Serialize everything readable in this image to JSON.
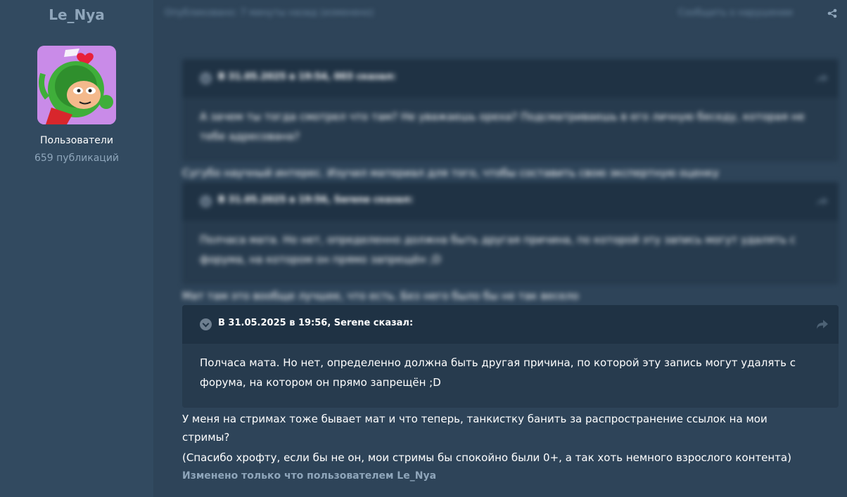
{
  "author": {
    "name": "Le_Nya",
    "group": "Пользователи",
    "posts": "659 публикаций"
  },
  "post_meta": {
    "published": "Опубликовано: 7 минуты назад (изменено)",
    "report": "Сообщить о нарушении"
  },
  "quotes": [
    {
      "title": "В 31.05.2025 в 19:54, 003 сказал:",
      "body": "А зачем ты тогда смотрел что там? Не уважаешь ореха? Подсматриваешь в его личную беседу, которая не тебе адресована?"
    },
    {
      "title": "В 31.05.2025 в 19:56, Serene сказал:",
      "body": "Полчаса мата. Но нет, определенно должна быть другая причина, по которой эту запись могут удалять с форума, на котором он прямо запрещён ;D"
    },
    {
      "title": "В 31.05.2025 в 19:56, Serene сказал:",
      "body": "Полчаса мата. Но нет, определенно должна быть другая причина, по которой эту запись могут удалять с форума, на котором он прямо запрещён ;D"
    }
  ],
  "replies": [
    "Сугубо научный интерес. Изучил материал для того, чтобы составить свою экспертную оценку",
    "Мат там это вообще лучшее, что есть. Без него было бы не так весело"
  ],
  "final_reply": {
    "line1": "У меня на стримах тоже бывает мат и что теперь, танкистку банить за распространение ссылок на мои",
    "line2": "стримы?",
    "line3": "(Спасибо хрофту, если бы не он, мои стримы бы спокойно были 0+, а так хоть немного взрослого контента)"
  },
  "edited_note": "Изменено только что пользователем Le_Nya"
}
